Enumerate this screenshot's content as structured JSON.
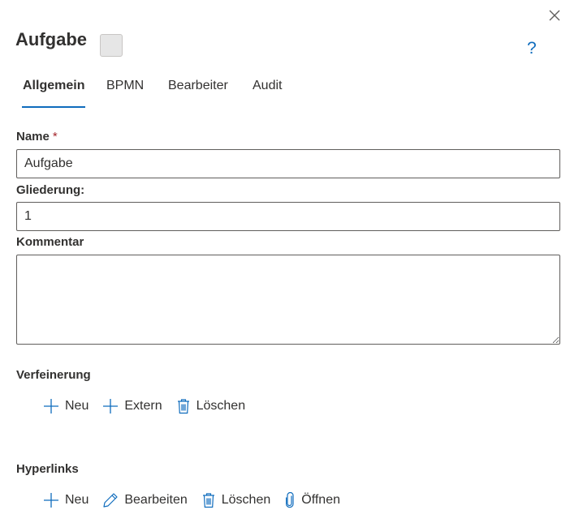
{
  "dialog": {
    "title": "Aufgabe",
    "help_glyph": "?"
  },
  "tabs": [
    {
      "label": "Allgemein",
      "active": true
    },
    {
      "label": "BPMN",
      "active": false
    },
    {
      "label": "Bearbeiter",
      "active": false
    },
    {
      "label": "Audit",
      "active": false
    }
  ],
  "form": {
    "name_label": "Name",
    "required_marker": "*",
    "name_value": "Aufgabe",
    "gliederung_label": "Gliederung:",
    "gliederung_value": "1",
    "kommentar_label": "Kommentar",
    "kommentar_value": ""
  },
  "verfeinerung": {
    "title": "Verfeinerung",
    "new_label": "Neu",
    "extern_label": "Extern",
    "delete_label": "Löschen"
  },
  "hyperlinks": {
    "title": "Hyperlinks",
    "new_label": "Neu",
    "edit_label": "Bearbeiten",
    "delete_label": "Löschen",
    "open_label": "Öffnen"
  },
  "colors": {
    "accent": "#0f6cbd",
    "text": "#323130",
    "required": "#a4262c",
    "swatch": "#e6e6e6"
  }
}
